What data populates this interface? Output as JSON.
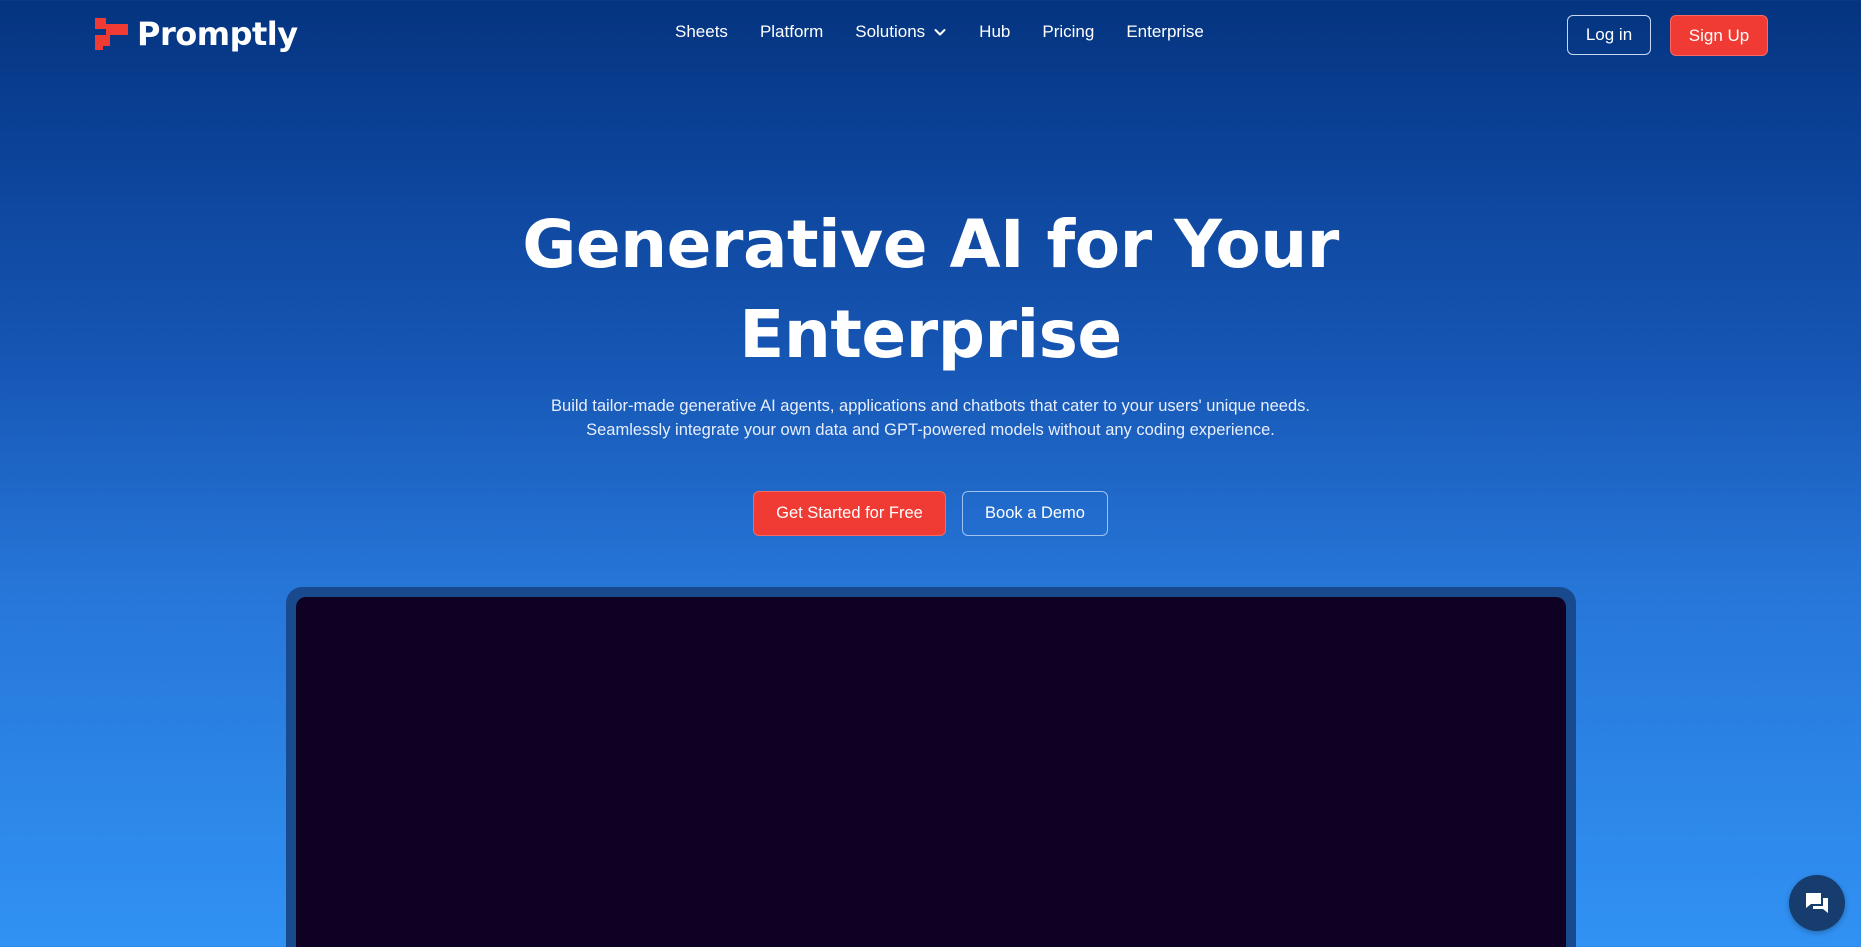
{
  "brand": {
    "name": "Promptly",
    "accent": "#ef3b33"
  },
  "nav": {
    "items": [
      {
        "label": "Sheets"
      },
      {
        "label": "Platform"
      },
      {
        "label": "Solutions",
        "icon": "chevron-down-icon"
      },
      {
        "label": "Hub"
      },
      {
        "label": "Pricing"
      },
      {
        "label": "Enterprise"
      }
    ]
  },
  "auth": {
    "login_label": "Log in",
    "signup_label": "Sign Up"
  },
  "hero": {
    "title_line1": "Generative AI for Your",
    "title_line2": "Enterprise",
    "subtitle_line1": "Build tailor-made generative AI agents, applications and chatbots that cater to your users' unique needs.",
    "subtitle_line2": "Seamlessly integrate your own data and GPT-powered models without any coding experience.",
    "primary_cta": "Get Started for Free",
    "secondary_cta": "Book a Demo"
  },
  "widgets": {
    "chat_icon": "chat-bubble-icon"
  },
  "colors": {
    "bg_top": "#04347f",
    "bg_bottom": "#3192f4",
    "video_bg": "#0f0123"
  }
}
